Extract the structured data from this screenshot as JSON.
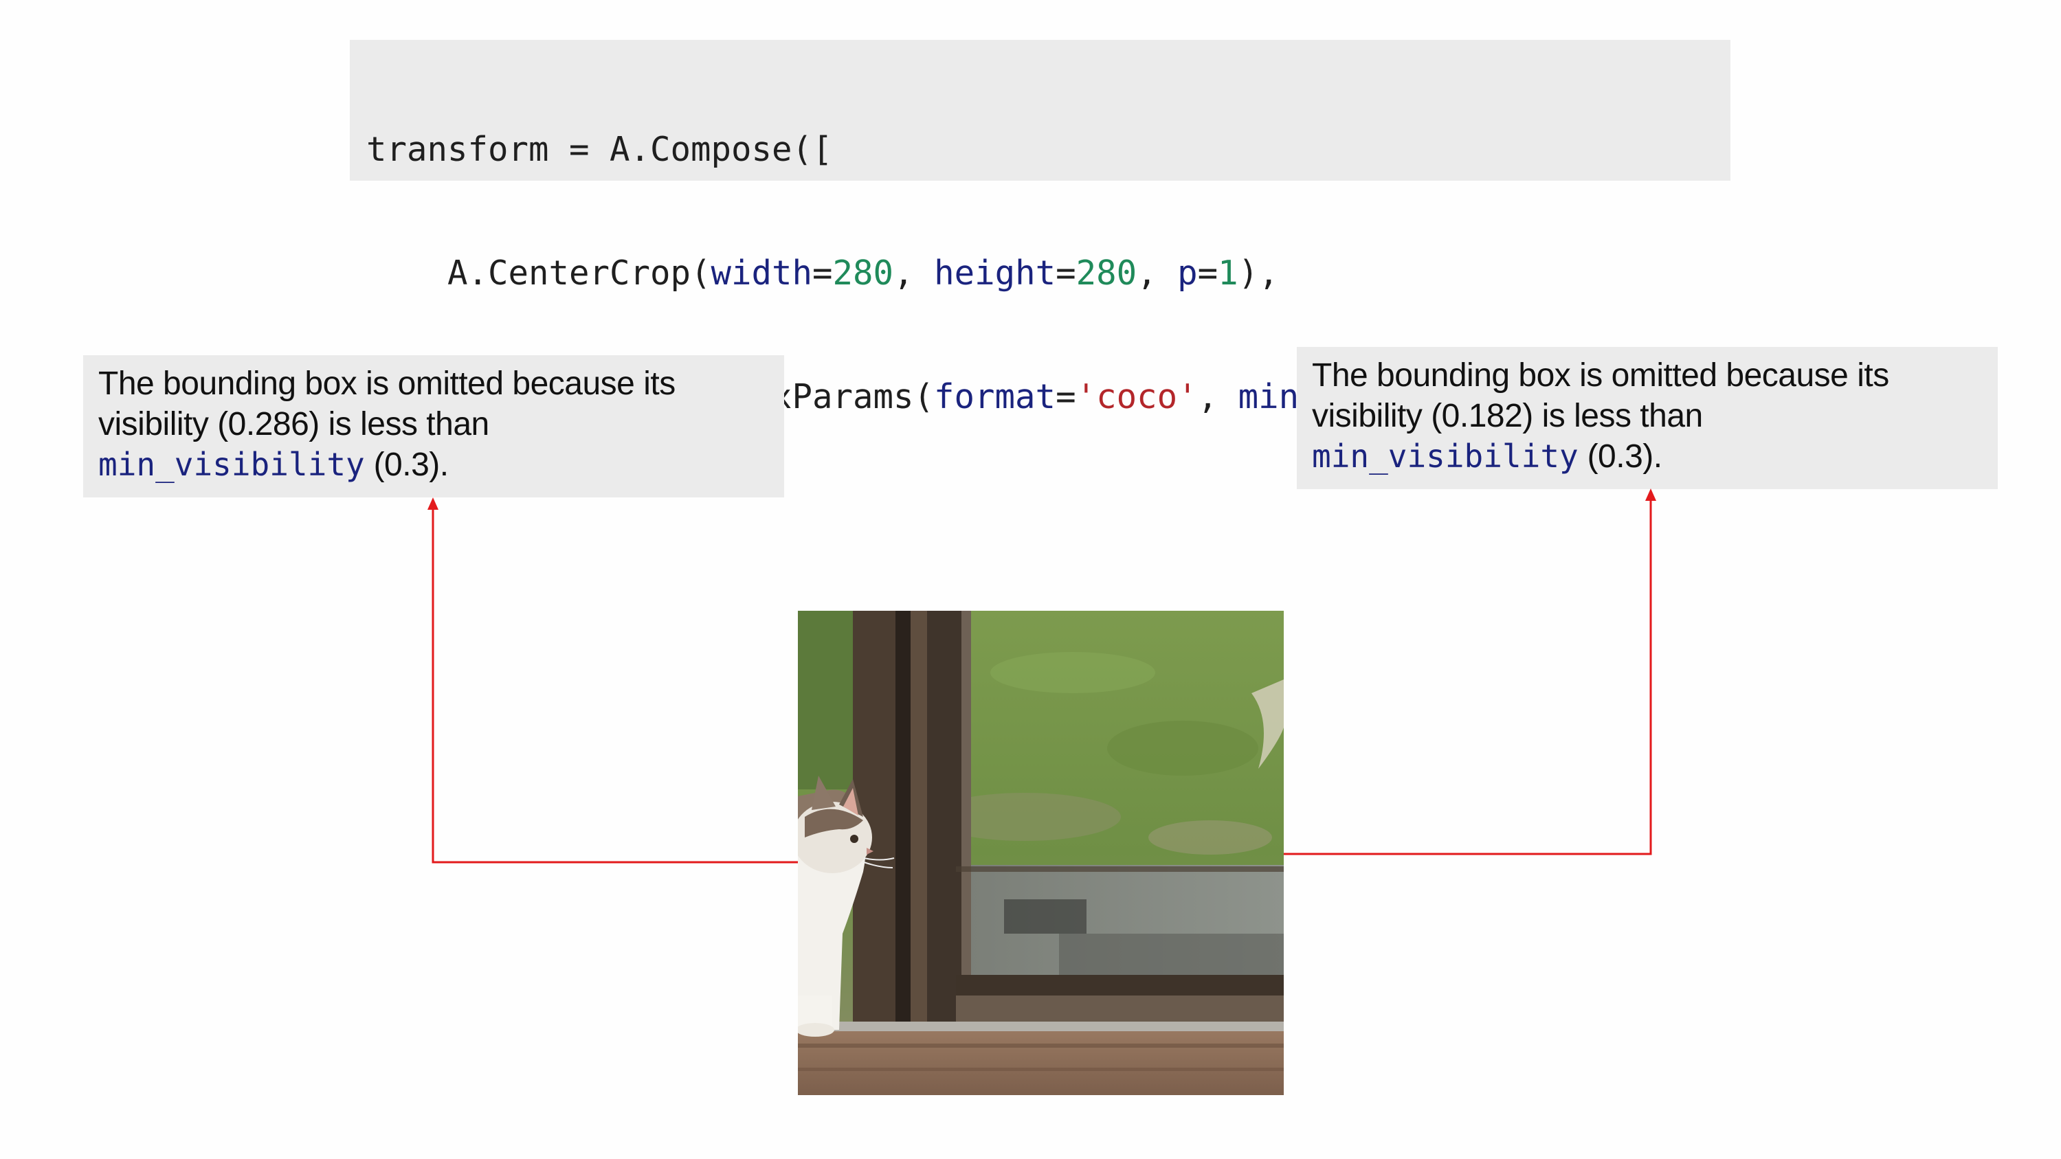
{
  "code": {
    "lines": [
      [
        {
          "t": "transform = A.Compose([",
          "c": "plain"
        }
      ],
      [
        {
          "t": "    A.CenterCrop(",
          "c": "plain"
        },
        {
          "t": "width",
          "c": "kw"
        },
        {
          "t": "=",
          "c": "plain"
        },
        {
          "t": "280",
          "c": "num"
        },
        {
          "t": ", ",
          "c": "plain"
        },
        {
          "t": "height",
          "c": "kw"
        },
        {
          "t": "=",
          "c": "plain"
        },
        {
          "t": "280",
          "c": "num"
        },
        {
          "t": ", ",
          "c": "plain"
        },
        {
          "t": "p",
          "c": "kw"
        },
        {
          "t": "=",
          "c": "plain"
        },
        {
          "t": "1",
          "c": "num"
        },
        {
          "t": "),",
          "c": "plain"
        }
      ],
      [
        {
          "t": "], ",
          "c": "plain"
        },
        {
          "t": "bbox_params",
          "c": "kw"
        },
        {
          "t": "=A.BboxParams(",
          "c": "plain"
        },
        {
          "t": "format",
          "c": "kw"
        },
        {
          "t": "=",
          "c": "plain"
        },
        {
          "t": "'coco'",
          "c": "str"
        },
        {
          "t": ", ",
          "c": "plain"
        },
        {
          "t": "min_visibility",
          "c": "kw"
        },
        {
          "t": "=",
          "c": "plain"
        },
        {
          "t": "0.3",
          "c": "num"
        },
        {
          "t": "))",
          "c": "plain"
        }
      ]
    ]
  },
  "left_note": {
    "line1": "The bounding box is omitted because its",
    "line2": "visibility (0.286) is less than",
    "param": "min_visibility",
    "value": " (0.3)."
  },
  "right_note": {
    "line1": "The bounding box is omitted because its",
    "line2": "visibility (0.182) is less than",
    "param": "min_visibility",
    "value": " (0.3)."
  },
  "colors": {
    "arrow": "#e31a1c",
    "keyword": "#1a237e",
    "number": "#1f8a5a",
    "string": "#b3262a",
    "panel": "#ebebeb"
  }
}
